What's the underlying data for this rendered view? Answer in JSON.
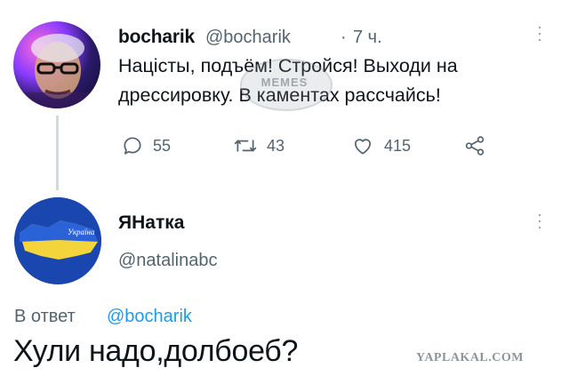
{
  "tweet": {
    "name": "bocharik",
    "handle": "@bocharik",
    "separator": "·",
    "time": "7 ч.",
    "text": "Націсты, подъём! Стройся! Выходи на дрессировку. В каментах рассчайсь!",
    "replies": "55",
    "retweets": "43",
    "likes": "415"
  },
  "reply": {
    "name": "ЯНатка",
    "handle": "@natalinabc",
    "in_reply_prefix": "В ответ",
    "in_reply_to": "@bocharik",
    "text": "Хули надо,долбоеб?"
  },
  "watermark": "MEMES",
  "site_mark": "YAPLAKAL.COM",
  "avatar2_label": "Україна",
  "colors": {
    "text": "#0f1419",
    "muted": "#536471",
    "link": "#1d9bf0",
    "thread_line": "#cfd9de"
  }
}
